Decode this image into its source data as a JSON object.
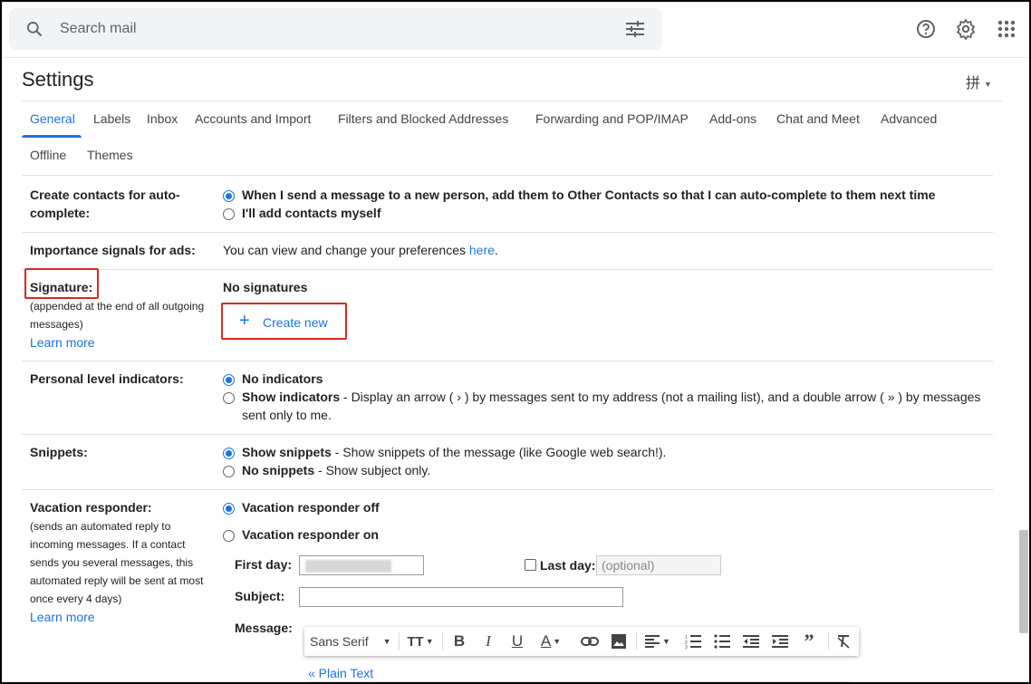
{
  "search": {
    "placeholder": "Search mail"
  },
  "top_icons": [
    "help-icon",
    "gear-icon",
    "apps-grid-icon"
  ],
  "page": {
    "title": "Settings",
    "input_tools_label": "拼"
  },
  "tabs": [
    "General",
    "Labels",
    "Inbox",
    "Accounts and Import",
    "Filters and Blocked Addresses",
    "Forwarding and POP/IMAP",
    "Add-ons",
    "Chat and Meet",
    "Advanced",
    "Offline",
    "Themes"
  ],
  "contacts": {
    "label_line1": "Create contacts for auto-",
    "label_line2": "complete:",
    "option1": "When I send a message to a new person, add them to Other Contacts so that I can auto-complete to them next time",
    "option2": "I'll add contacts myself"
  },
  "importance": {
    "label": "Importance signals for ads:",
    "text": "You can view and change your preferences ",
    "link": "here",
    "suffix": "."
  },
  "signature": {
    "label": "Signature:",
    "sub1": "(appended at the end of all outgoing",
    "sub2": "messages)",
    "learn_more": "Learn more",
    "status": "No signatures",
    "create_new": "Create new"
  },
  "personal": {
    "label": "Personal level indicators:",
    "option1": "No indicators",
    "option2_bold": "Show indicators",
    "option2_text": " - Display an arrow ( › ) by messages sent to my address (not a mailing list), and a double arrow ( » ) by messages",
    "option2_text2": "sent only to me."
  },
  "snippets": {
    "label": "Snippets:",
    "option1_bold": "Show snippets",
    "option1_text": " - Show snippets of the message (like Google web search!).",
    "option2_bold": "No snippets",
    "option2_text": " - Show subject only."
  },
  "vacation": {
    "label": "Vacation responder:",
    "sub1": "(sends an automated reply to",
    "sub2": "incoming messages. If a contact",
    "sub3": "sends you several messages, this",
    "sub4": "automated reply will be sent at most",
    "sub5": "once every 4 days)",
    "learn_more": "Learn more",
    "option_off": "Vacation responder off",
    "option_on": "Vacation responder on",
    "first_day": "First day:",
    "last_day": "Last day:",
    "last_day_placeholder": "(optional)",
    "subject": "Subject:",
    "message": "Message:",
    "font": "Sans Serif",
    "plain_text": "« Plain Text"
  },
  "colors": {
    "accent": "#1a73e8",
    "highlight": "#e0261f"
  }
}
